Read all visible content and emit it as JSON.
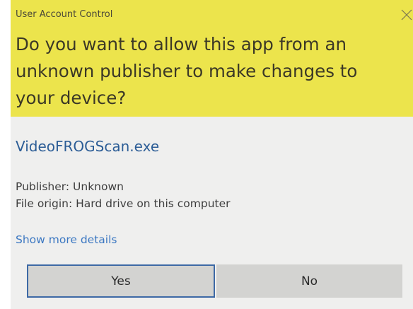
{
  "dialog": {
    "title": "User Account Control",
    "question": "Do you want to allow this app from an unknown publisher to make changes to your device?",
    "app_name": "VideoFROGScan.exe",
    "publisher": "Publisher: Unknown",
    "file_origin": "File origin: Hard drive on this computer",
    "show_more_details": "Show more details",
    "buttons": {
      "yes": "Yes",
      "no": "No"
    },
    "close_icon": "close-icon"
  },
  "colors": {
    "banner": "#ece44c",
    "body": "#efefee",
    "app_name": "#2c5d96",
    "link": "#3c78c2",
    "button": "#d3d3d1",
    "button_focus_border": "#3d69a5"
  }
}
